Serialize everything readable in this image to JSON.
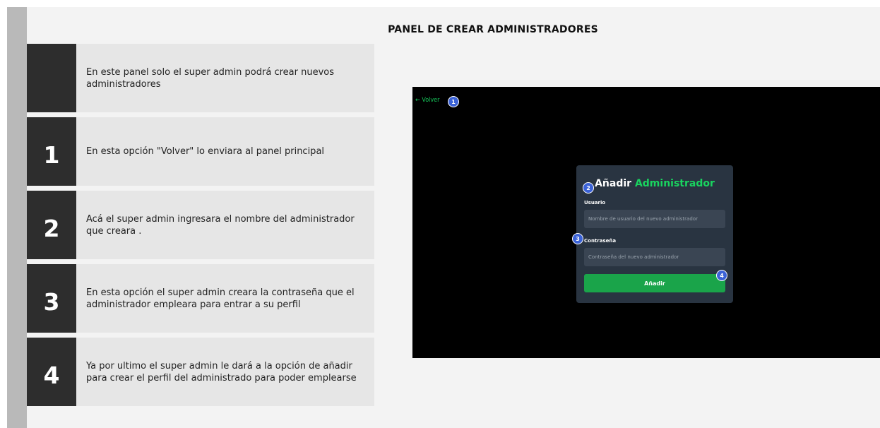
{
  "title": "PANEL DE CREAR ADMINISTRADORES",
  "steps": [
    {
      "num": "",
      "text": "En este panel solo el super admin podrá crear nuevos administradores"
    },
    {
      "num": "1",
      "text": "En esta opción \"Volver\" lo enviara al panel principal"
    },
    {
      "num": "2",
      "text": "Acá el super admin ingresara el nombre del administrador que creara ."
    },
    {
      "num": "3",
      "text": "En esta opción el super admin creara la contraseña que el administrador empleara para entrar a su perfil"
    },
    {
      "num": "4",
      "text": "Ya por ultimo el super admin le dará a la opción de añadir para crear el perfil del administrado para poder emplearse"
    }
  ],
  "screenshot": {
    "back_label": "← Volver",
    "card_title_prefix": "Añadir",
    "card_title_accent": "Administrador",
    "user_label": "Usuario",
    "user_placeholder": "Nombre de usuario del nuevo administrador",
    "password_label": "Contraseña",
    "password_placeholder": "Contraseña del nuevo administrador",
    "add_button": "Añadir",
    "badges": [
      "1",
      "2",
      "3",
      "4"
    ]
  },
  "colors": {
    "accent": "#19d45f",
    "badge": "#3b62d6",
    "card": "#293441",
    "button": "#1aa44a"
  }
}
